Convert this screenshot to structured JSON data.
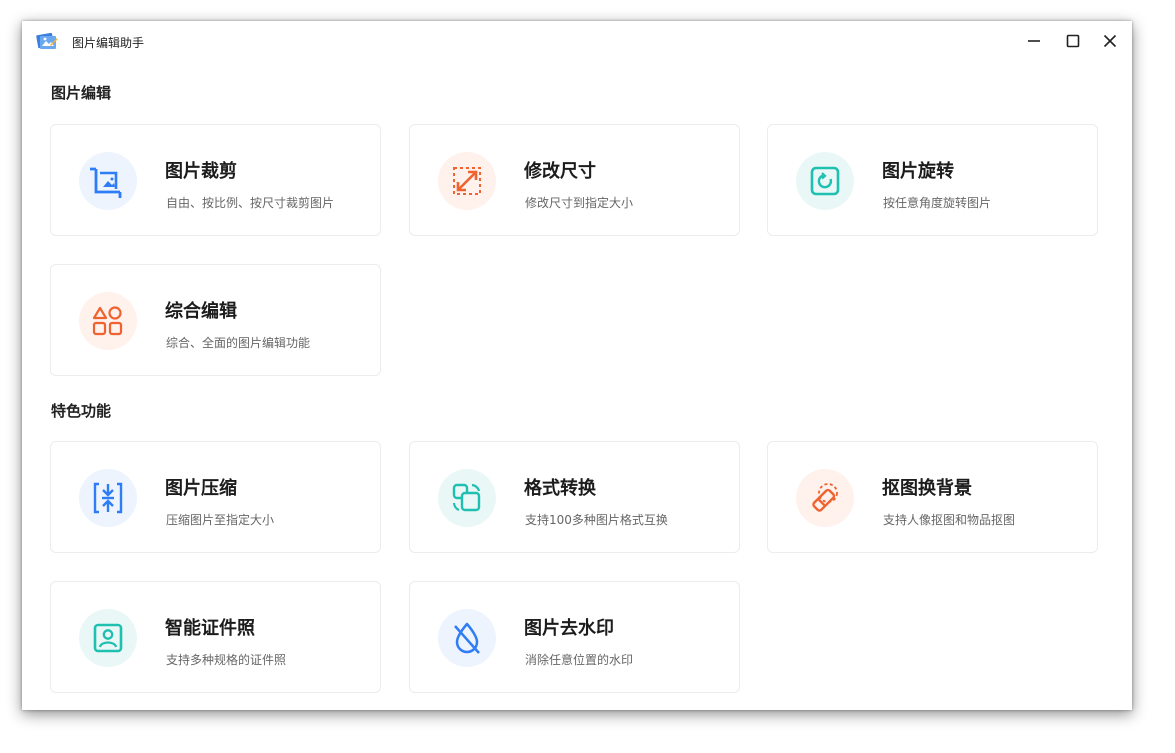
{
  "app": {
    "title": "图片编辑助手"
  },
  "window_controls": {
    "minimize": "minimize-icon",
    "maximize": "maximize-icon",
    "close": "close-icon"
  },
  "sections": [
    {
      "title": "图片编辑",
      "cards": [
        {
          "title": "图片裁剪",
          "desc": "自由、按比例、按尺寸裁剪图片",
          "icon": "crop-icon",
          "color": "#2f7df6"
        },
        {
          "title": "修改尺寸",
          "desc": "修改尺寸到指定大小",
          "icon": "resize-icon",
          "color": "#f0622f"
        },
        {
          "title": "图片旋转",
          "desc": "按任意角度旋转图片",
          "icon": "rotate-icon",
          "color": "#1fbfb1"
        },
        {
          "title": "综合编辑",
          "desc": "综合、全面的图片编辑功能",
          "icon": "shapes-icon",
          "color": "#f0622f"
        }
      ]
    },
    {
      "title": "特色功能",
      "cards": [
        {
          "title": "图片压缩",
          "desc": "压缩图片至指定大小",
          "icon": "compress-icon",
          "color": "#2f7df6"
        },
        {
          "title": "格式转换",
          "desc": "支持100多种图片格式互换",
          "icon": "convert-icon",
          "color": "#1fbfb1"
        },
        {
          "title": "抠图换背景",
          "desc": "支持人像抠图和物品抠图",
          "icon": "eraser-icon",
          "color": "#f0622f"
        },
        {
          "title": "智能证件照",
          "desc": "支持多种规格的证件照",
          "icon": "id-photo-icon",
          "color": "#1fbfb1"
        },
        {
          "title": "图片去水印",
          "desc": "消除任意位置的水印",
          "icon": "remove-watermark-icon",
          "color": "#2f7df6"
        }
      ]
    }
  ]
}
